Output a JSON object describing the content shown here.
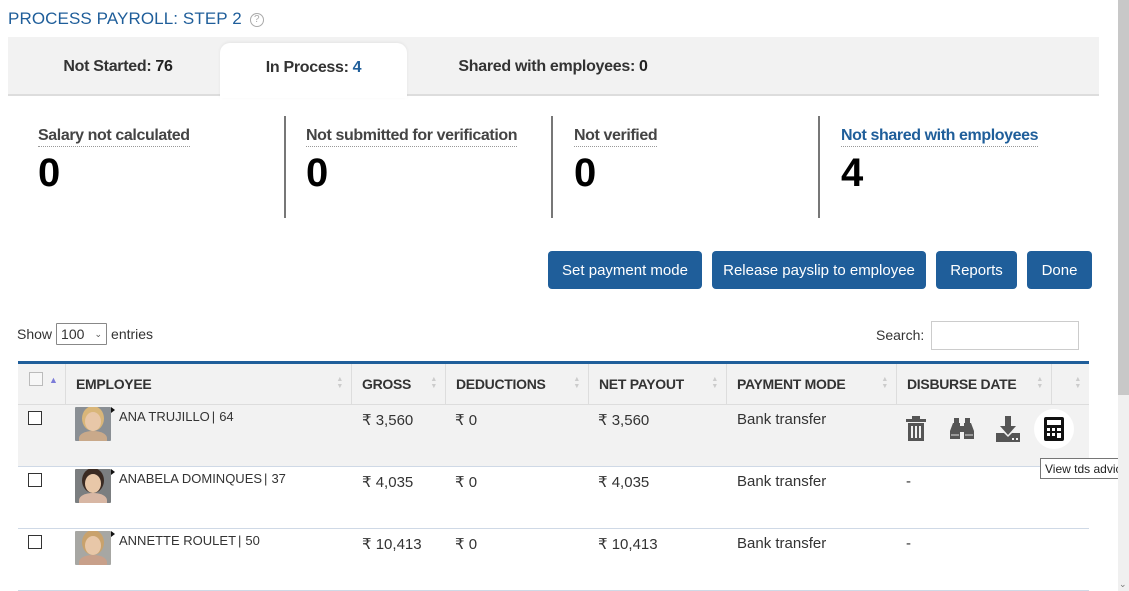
{
  "page": {
    "title": "PROCESS PAYROLL: STEP 2",
    "help_icon": "question-circle-icon"
  },
  "tabs": [
    {
      "label": "Not Started:",
      "count": "76",
      "active": false
    },
    {
      "label": "In Process:",
      "count": "4",
      "active": true
    },
    {
      "label": "Shared with employees:",
      "count": "0",
      "active": false
    }
  ],
  "stats": [
    {
      "label": "Salary not calculated",
      "value": "0"
    },
    {
      "label": "Not submitted for verification",
      "value": "0"
    },
    {
      "label": "Not verified",
      "value": "0"
    },
    {
      "label": "Not shared with employees",
      "value": "4"
    }
  ],
  "actions": {
    "set_payment_mode": "Set payment mode",
    "release_payslip": "Release payslip to employee",
    "reports": "Reports",
    "done": "Done"
  },
  "table_controls": {
    "show_label": "Show",
    "entries_value": "100",
    "entries_label": "entries",
    "search_label": "Search:",
    "search_value": ""
  },
  "table": {
    "columns": [
      "EMPLOYEE",
      "GROSS",
      "DEDUCTIONS",
      "NET PAYOUT",
      "PAYMENT MODE",
      "DISBURSE DATE",
      ""
    ],
    "sort": {
      "column": "select",
      "direction": "asc"
    },
    "rows": [
      {
        "name": "ANA TRUJILLO",
        "sep": "|",
        "id": "64",
        "gross": "₹ 3,560",
        "deductions": "₹ 0",
        "net": "₹ 3,560",
        "mode": "Bank transfer",
        "date": "",
        "hair": "#d9b679",
        "shirt": "#c9a98a",
        "bg": "#8a8f94"
      },
      {
        "name": "ANABELA DOMINQUES",
        "sep": "|",
        "id": "37",
        "gross": "₹ 4,035",
        "deductions": "₹ 0",
        "net": "₹ 4,035",
        "mode": "Bank transfer",
        "date": "-",
        "hair": "#3a2a22",
        "shirt": "#d8b7a4",
        "bg": "#7b7e80"
      },
      {
        "name": "ANNETTE ROULET",
        "sep": "|",
        "id": "50",
        "gross": "₹ 10,413",
        "deductions": "₹ 0",
        "net": "₹ 10,413",
        "mode": "Bank transfer",
        "date": "-",
        "hair": "#c9a26c",
        "shirt": "#c8a08a",
        "bg": "#a7a7a3"
      }
    ],
    "row_actions": [
      {
        "icon": "trash-icon",
        "label": "Delete"
      },
      {
        "icon": "binoculars-icon",
        "label": "View"
      },
      {
        "icon": "download-icon",
        "label": "Download"
      },
      {
        "icon": "calculator-icon",
        "label": "View tds advice"
      }
    ]
  },
  "tooltip": "View tds advice",
  "colors": {
    "accent": "#1f5e9a",
    "tab_bar": "#f2f2f2",
    "row_highlight": "#f2f2f2"
  }
}
